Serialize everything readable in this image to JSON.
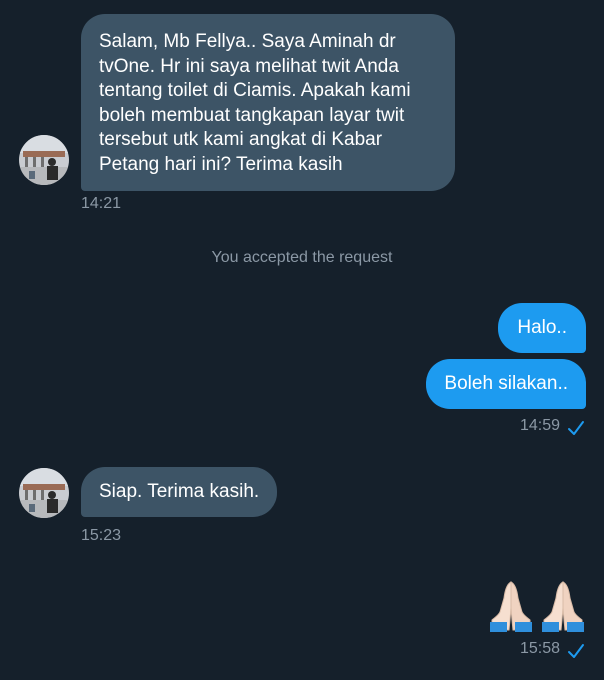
{
  "conversation": {
    "msg1": {
      "text": "Salam, Mb Fellya.. Saya Aminah dr tvOne. Hr ini saya melihat twit Anda tentang toilet di Ciamis. Apakah kami boleh membuat tangkapan layar twit tersebut utk kami angkat di Kabar Petang hari ini? Terima kasih",
      "time": "14:21"
    },
    "system_notice": "You accepted the request",
    "out1": {
      "text": "Halo.."
    },
    "out2": {
      "text": "Boleh silakan..",
      "time": "14:59"
    },
    "msg2": {
      "text": "Siap. Terima kasih.",
      "time": "15:23"
    },
    "out3": {
      "emoji": "🙏🏻",
      "emoji_count": 2,
      "time": "15:58"
    }
  },
  "colors": {
    "background": "#15202b",
    "incoming_bubble": "#3d5466",
    "outgoing_bubble": "#1d9bf0",
    "secondary_text": "#8b98a5"
  },
  "icons": {
    "read_receipt": "checkmark-icon",
    "avatar": "user-avatar"
  }
}
